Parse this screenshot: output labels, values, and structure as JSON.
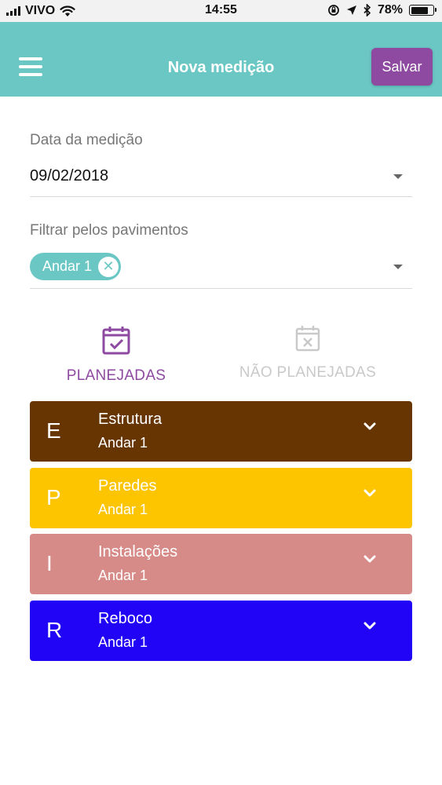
{
  "status_bar": {
    "carrier": "VIVO",
    "time": "14:55",
    "battery": "78%",
    "battery_level": 0.78
  },
  "app_bar": {
    "title": "Nova medição",
    "save_label": "Salvar",
    "menu_icon": "hamburger-icon"
  },
  "date_field": {
    "label": "Data da medição",
    "value": "09/02/2018"
  },
  "floor_filter": {
    "label": "Filtrar pelos pavimentos",
    "chips": [
      {
        "label": "Andar 1"
      }
    ]
  },
  "tabs": [
    {
      "label": "PLANEJADAS",
      "icon": "calendar-check-icon",
      "active": true
    },
    {
      "label": "NÃO PLANEJADAS",
      "icon": "calendar-x-icon",
      "active": false
    }
  ],
  "cards": [
    {
      "letter": "E",
      "title": "Estrutura",
      "subtitle": "Andar 1",
      "color": "#673502"
    },
    {
      "letter": "P",
      "title": "Paredes",
      "subtitle": "Andar 1",
      "color": "#fdc400"
    },
    {
      "letter": "I",
      "title": "Instalações",
      "subtitle": "Andar 1",
      "color": "#d78b88"
    },
    {
      "letter": "R",
      "title": "Reboco",
      "subtitle": "Andar 1",
      "color": "#2103f5"
    }
  ],
  "colors": {
    "primary": "#6ac7c4",
    "accent": "#8e4aa0",
    "inactive": "#c9c9c9"
  }
}
